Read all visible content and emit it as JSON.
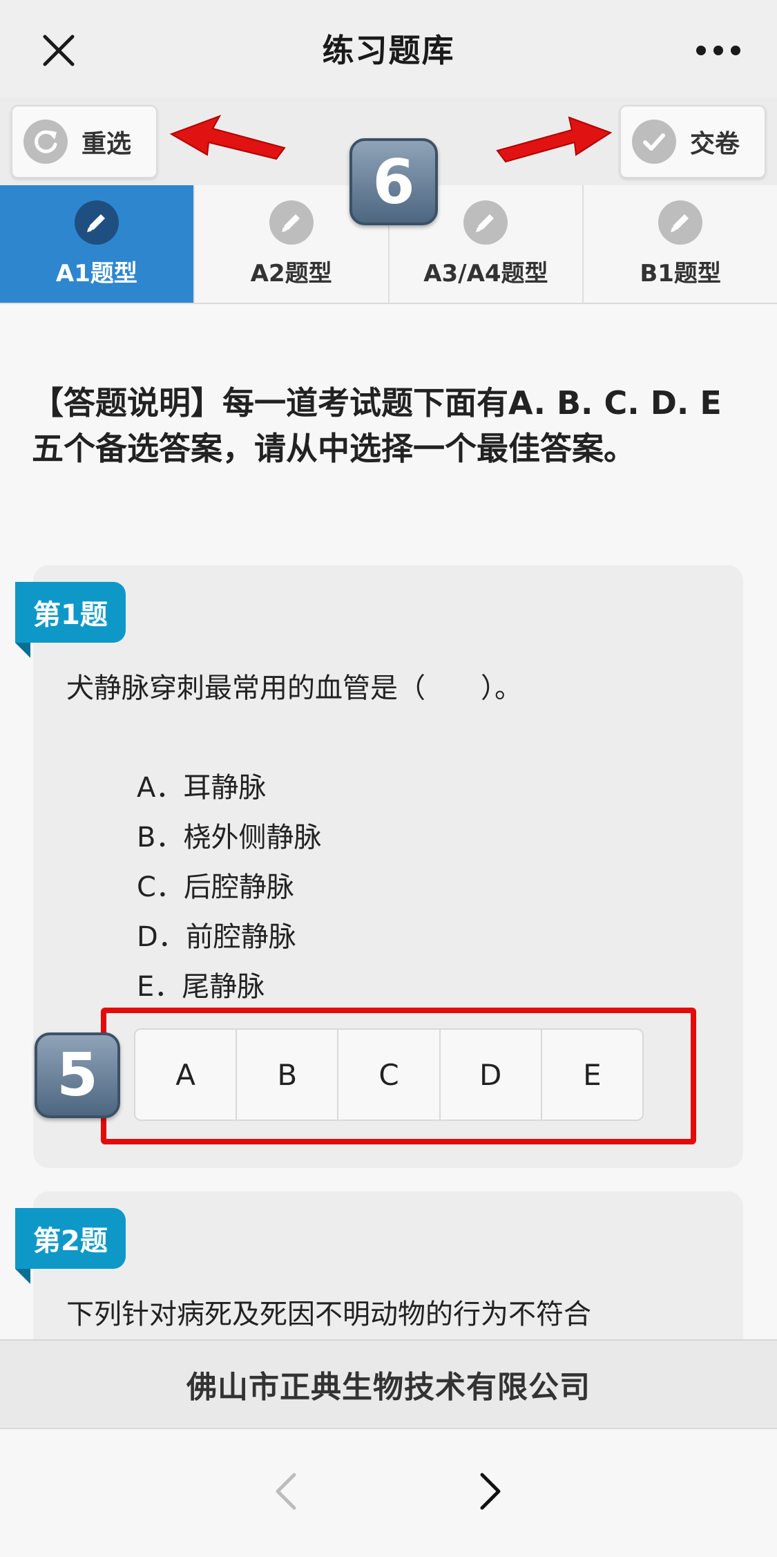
{
  "titlebar": {
    "title": "练习题库"
  },
  "toolbar": {
    "reset_label": "重选",
    "submit_label": "交卷"
  },
  "badges": {
    "top": "6",
    "answers": "5"
  },
  "tabs": [
    {
      "label": "A1题型",
      "active": true
    },
    {
      "label": "A2题型",
      "active": false
    },
    {
      "label": "A3/A4题型",
      "active": false
    },
    {
      "label": "B1题型",
      "active": false
    }
  ],
  "instructions": "【答题说明】每一道考试题下面有A. B. C. D. E五个备选答案，请从中选择一个最佳答案。",
  "questions": [
    {
      "tag": "第1题",
      "text": "犬静脉穿刺最常用的血管是（　　）。",
      "options": [
        "A．耳静脉",
        "B．桡外侧静脉",
        "C．后腔静脉",
        "D．前腔静脉",
        "E．尾静脉"
      ],
      "answers": [
        "A",
        "B",
        "C",
        "D",
        "E"
      ]
    },
    {
      "tag": "第2题",
      "text": "下列针对病死及死因不明动物的行为不符合"
    }
  ],
  "footer": {
    "company": "佛山市正典生物技术有限公司"
  },
  "colors": {
    "accent": "#2e86cf",
    "tag": "#0e98c8",
    "highlight": "#e30a0a",
    "arrow": "#e11212"
  }
}
